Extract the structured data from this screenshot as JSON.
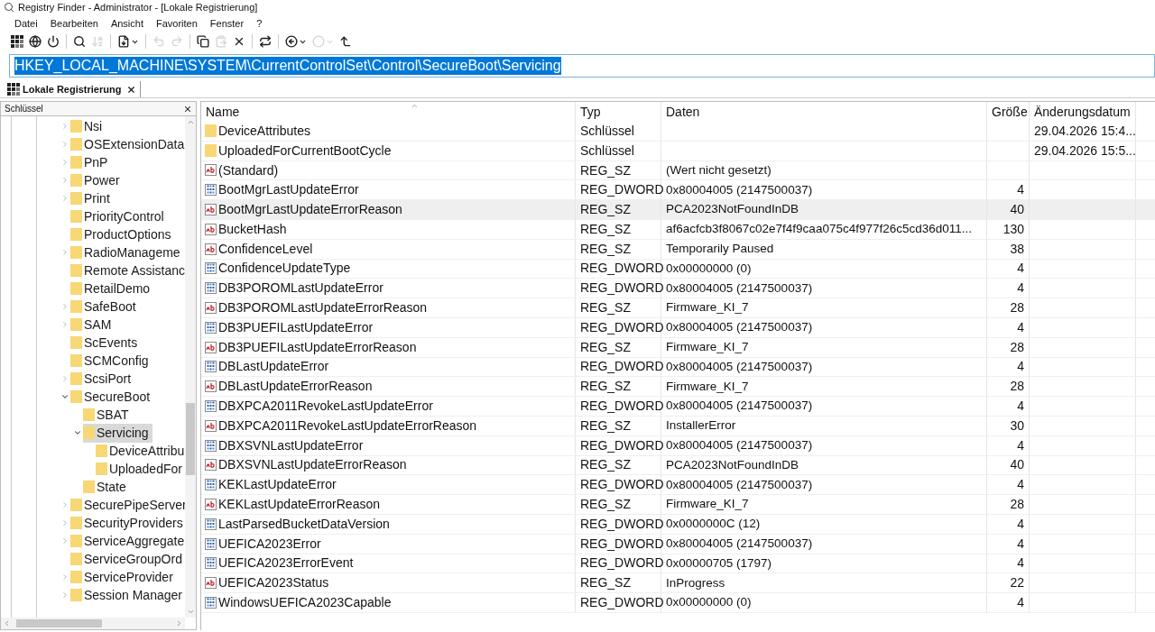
{
  "window": {
    "title": "Registry Finder - Administrator - [Lokale Registrierung]"
  },
  "menu": [
    "Datei",
    "Bearbeiten",
    "Ansicht",
    "Favoriten",
    "Fenster",
    "?"
  ],
  "toolbar": [
    {
      "kind": "grid",
      "disabled": false
    },
    {
      "kind": "globe",
      "disabled": false
    },
    {
      "kind": "power",
      "disabled": false
    },
    {
      "kind": "sep"
    },
    {
      "kind": "search",
      "disabled": false
    },
    {
      "kind": "sort",
      "disabled": true
    },
    {
      "kind": "sep"
    },
    {
      "kind": "export",
      "disabled": false
    },
    {
      "kind": "sep"
    },
    {
      "kind": "undo",
      "disabled": true
    },
    {
      "kind": "redo",
      "disabled": true
    },
    {
      "kind": "sep"
    },
    {
      "kind": "copy",
      "disabled": false
    },
    {
      "kind": "paste",
      "disabled": true
    },
    {
      "kind": "delete",
      "disabled": false
    },
    {
      "kind": "sep"
    },
    {
      "kind": "refresh",
      "disabled": false
    },
    {
      "kind": "sep"
    },
    {
      "kind": "back",
      "disabled": false
    },
    {
      "kind": "forward",
      "disabled": true
    },
    {
      "kind": "up",
      "disabled": false
    }
  ],
  "address": {
    "value": "HKEY_LOCAL_MACHINE\\SYSTEM\\CurrentControlSet\\Control\\SecureBoot\\Servicing"
  },
  "tabs": [
    {
      "label": "Lokale Registrierung",
      "selected": true
    }
  ],
  "tree_pane": {
    "title": "Schlüssel",
    "items": [
      {
        "label": "Nsi",
        "expanded": false,
        "selected": false
      },
      {
        "label": "OSExtensionData",
        "expanded": false,
        "selected": false
      },
      {
        "label": "PnP",
        "expanded": false,
        "selected": false
      },
      {
        "label": "Power",
        "expanded": false,
        "selected": false
      },
      {
        "label": "Print",
        "expanded": false,
        "selected": false
      },
      {
        "label": "PriorityControl",
        "selected": false
      },
      {
        "label": "ProductOptions",
        "selected": false
      },
      {
        "label": "RadioManageme",
        "expanded": false,
        "selected": false
      },
      {
        "label": "Remote Assistanc",
        "selected": false
      },
      {
        "label": "RetailDemo",
        "selected": false
      },
      {
        "label": "SafeBoot",
        "expanded": false,
        "selected": false
      },
      {
        "label": "SAM",
        "expanded": false,
        "selected": false
      },
      {
        "label": "ScEvents",
        "selected": false
      },
      {
        "label": "SCMConfig",
        "selected": false
      },
      {
        "label": "ScsiPort",
        "expanded": false,
        "selected": false
      },
      {
        "label": "SecureBoot",
        "expanded": true,
        "selected": false,
        "children": [
          {
            "label": "SBAT",
            "selected": false
          },
          {
            "label": "Servicing",
            "expanded": true,
            "selected": true,
            "children": [
              {
                "label": "DeviceAttribu",
                "selected": false
              },
              {
                "label": "UploadedFor",
                "selected": false
              }
            ]
          },
          {
            "label": "State",
            "selected": false
          }
        ]
      },
      {
        "label": "SecurePipeServer",
        "expanded": false,
        "selected": false
      },
      {
        "label": "SecurityProviders",
        "expanded": false,
        "selected": false
      },
      {
        "label": "ServiceAggregate",
        "expanded": false,
        "selected": false
      },
      {
        "label": "ServiceGroupOrd",
        "selected": false
      },
      {
        "label": "ServiceProvider",
        "expanded": false,
        "selected": false
      },
      {
        "label": "Session Manager",
        "expanded": false,
        "selected": false
      }
    ]
  },
  "table": {
    "columns": [
      "Name",
      "Typ",
      "Daten",
      "Größe",
      "Änderungsdatum"
    ],
    "rows": [
      {
        "kind": "folder",
        "name": "DeviceAttributes",
        "type": "Schlüssel",
        "date": "29.04.2026 15:4...",
        "selected": false
      },
      {
        "kind": "folder",
        "name": "UploadedForCurrentBootCycle",
        "type": "Schlüssel",
        "date": "29.04.2026 15:5...",
        "selected": false
      },
      {
        "kind": "string",
        "name": "(Standard)",
        "type": "REG_SZ",
        "data": "(Wert nicht gesetzt)",
        "selected": false
      },
      {
        "kind": "binary",
        "name": "BootMgrLastUpdateError",
        "type": "REG_DWORD",
        "data": "0x80004005 (2147500037)",
        "size": "4",
        "selected": false
      },
      {
        "kind": "string",
        "name": "BootMgrLastUpdateErrorReason",
        "type": "REG_SZ",
        "data": "PCA2023NotFoundInDB",
        "size": "40",
        "selected": true
      },
      {
        "kind": "string",
        "name": "BucketHash",
        "type": "REG_SZ",
        "data": "af6acfcb3f8067c02e7f4f9caa075c4f977f26c5cd36d011...",
        "size": "130",
        "selected": false
      },
      {
        "kind": "string",
        "name": "ConfidenceLevel",
        "type": "REG_SZ",
        "data": "Temporarily Paused",
        "size": "38",
        "selected": false
      },
      {
        "kind": "binary",
        "name": "ConfidenceUpdateType",
        "type": "REG_DWORD",
        "data": "0x00000000 (0)",
        "size": "4",
        "selected": false
      },
      {
        "kind": "binary",
        "name": "DB3POROMLastUpdateError",
        "type": "REG_DWORD",
        "data": "0x80004005 (2147500037)",
        "size": "4",
        "selected": false
      },
      {
        "kind": "string",
        "name": "DB3POROMLastUpdateErrorReason",
        "type": "REG_SZ",
        "data": "Firmware_KI_7",
        "size": "28",
        "selected": false
      },
      {
        "kind": "binary",
        "name": "DB3PUEFILastUpdateError",
        "type": "REG_DWORD",
        "data": "0x80004005 (2147500037)",
        "size": "4",
        "selected": false
      },
      {
        "kind": "string",
        "name": "DB3PUEFILastUpdateErrorReason",
        "type": "REG_SZ",
        "data": "Firmware_KI_7",
        "size": "28",
        "selected": false
      },
      {
        "kind": "binary",
        "name": "DBLastUpdateError",
        "type": "REG_DWORD",
        "data": "0x80004005 (2147500037)",
        "size": "4",
        "selected": false
      },
      {
        "kind": "string",
        "name": "DBLastUpdateErrorReason",
        "type": "REG_SZ",
        "data": "Firmware_KI_7",
        "size": "28",
        "selected": false
      },
      {
        "kind": "binary",
        "name": "DBXPCA2011RevokeLastUpdateError",
        "type": "REG_DWORD",
        "data": "0x80004005 (2147500037)",
        "size": "4",
        "selected": false
      },
      {
        "kind": "string",
        "name": "DBXPCA2011RevokeLastUpdateErrorReason",
        "type": "REG_SZ",
        "data": "InstallerError",
        "size": "30",
        "selected": false
      },
      {
        "kind": "binary",
        "name": "DBXSVNLastUpdateError",
        "type": "REG_DWORD",
        "data": "0x80004005 (2147500037)",
        "size": "4",
        "selected": false
      },
      {
        "kind": "string",
        "name": "DBXSVNLastUpdateErrorReason",
        "type": "REG_SZ",
        "data": "PCA2023NotFoundInDB",
        "size": "40",
        "selected": false
      },
      {
        "kind": "binary",
        "name": "KEKLastUpdateError",
        "type": "REG_DWORD",
        "data": "0x80004005 (2147500037)",
        "size": "4",
        "selected": false
      },
      {
        "kind": "string",
        "name": "KEKLastUpdateErrorReason",
        "type": "REG_SZ",
        "data": "Firmware_KI_7",
        "size": "28",
        "selected": false
      },
      {
        "kind": "binary",
        "name": "LastParsedBucketDataVersion",
        "type": "REG_DWORD",
        "data": "0x0000000C (12)",
        "size": "4",
        "selected": false
      },
      {
        "kind": "binary",
        "name": "UEFICA2023Error",
        "type": "REG_DWORD",
        "data": "0x80004005 (2147500037)",
        "size": "4",
        "selected": false
      },
      {
        "kind": "binary",
        "name": "UEFICA2023ErrorEvent",
        "type": "REG_DWORD",
        "data": "0x00000705 (1797)",
        "size": "4",
        "selected": false
      },
      {
        "kind": "string",
        "name": "UEFICA2023Status",
        "type": "REG_SZ",
        "data": "InProgress",
        "size": "22",
        "selected": false
      },
      {
        "kind": "binary",
        "name": "WindowsUEFICA2023Capable",
        "type": "REG_DWORD",
        "data": "0x00000000 (0)",
        "size": "4",
        "selected": false
      }
    ]
  }
}
